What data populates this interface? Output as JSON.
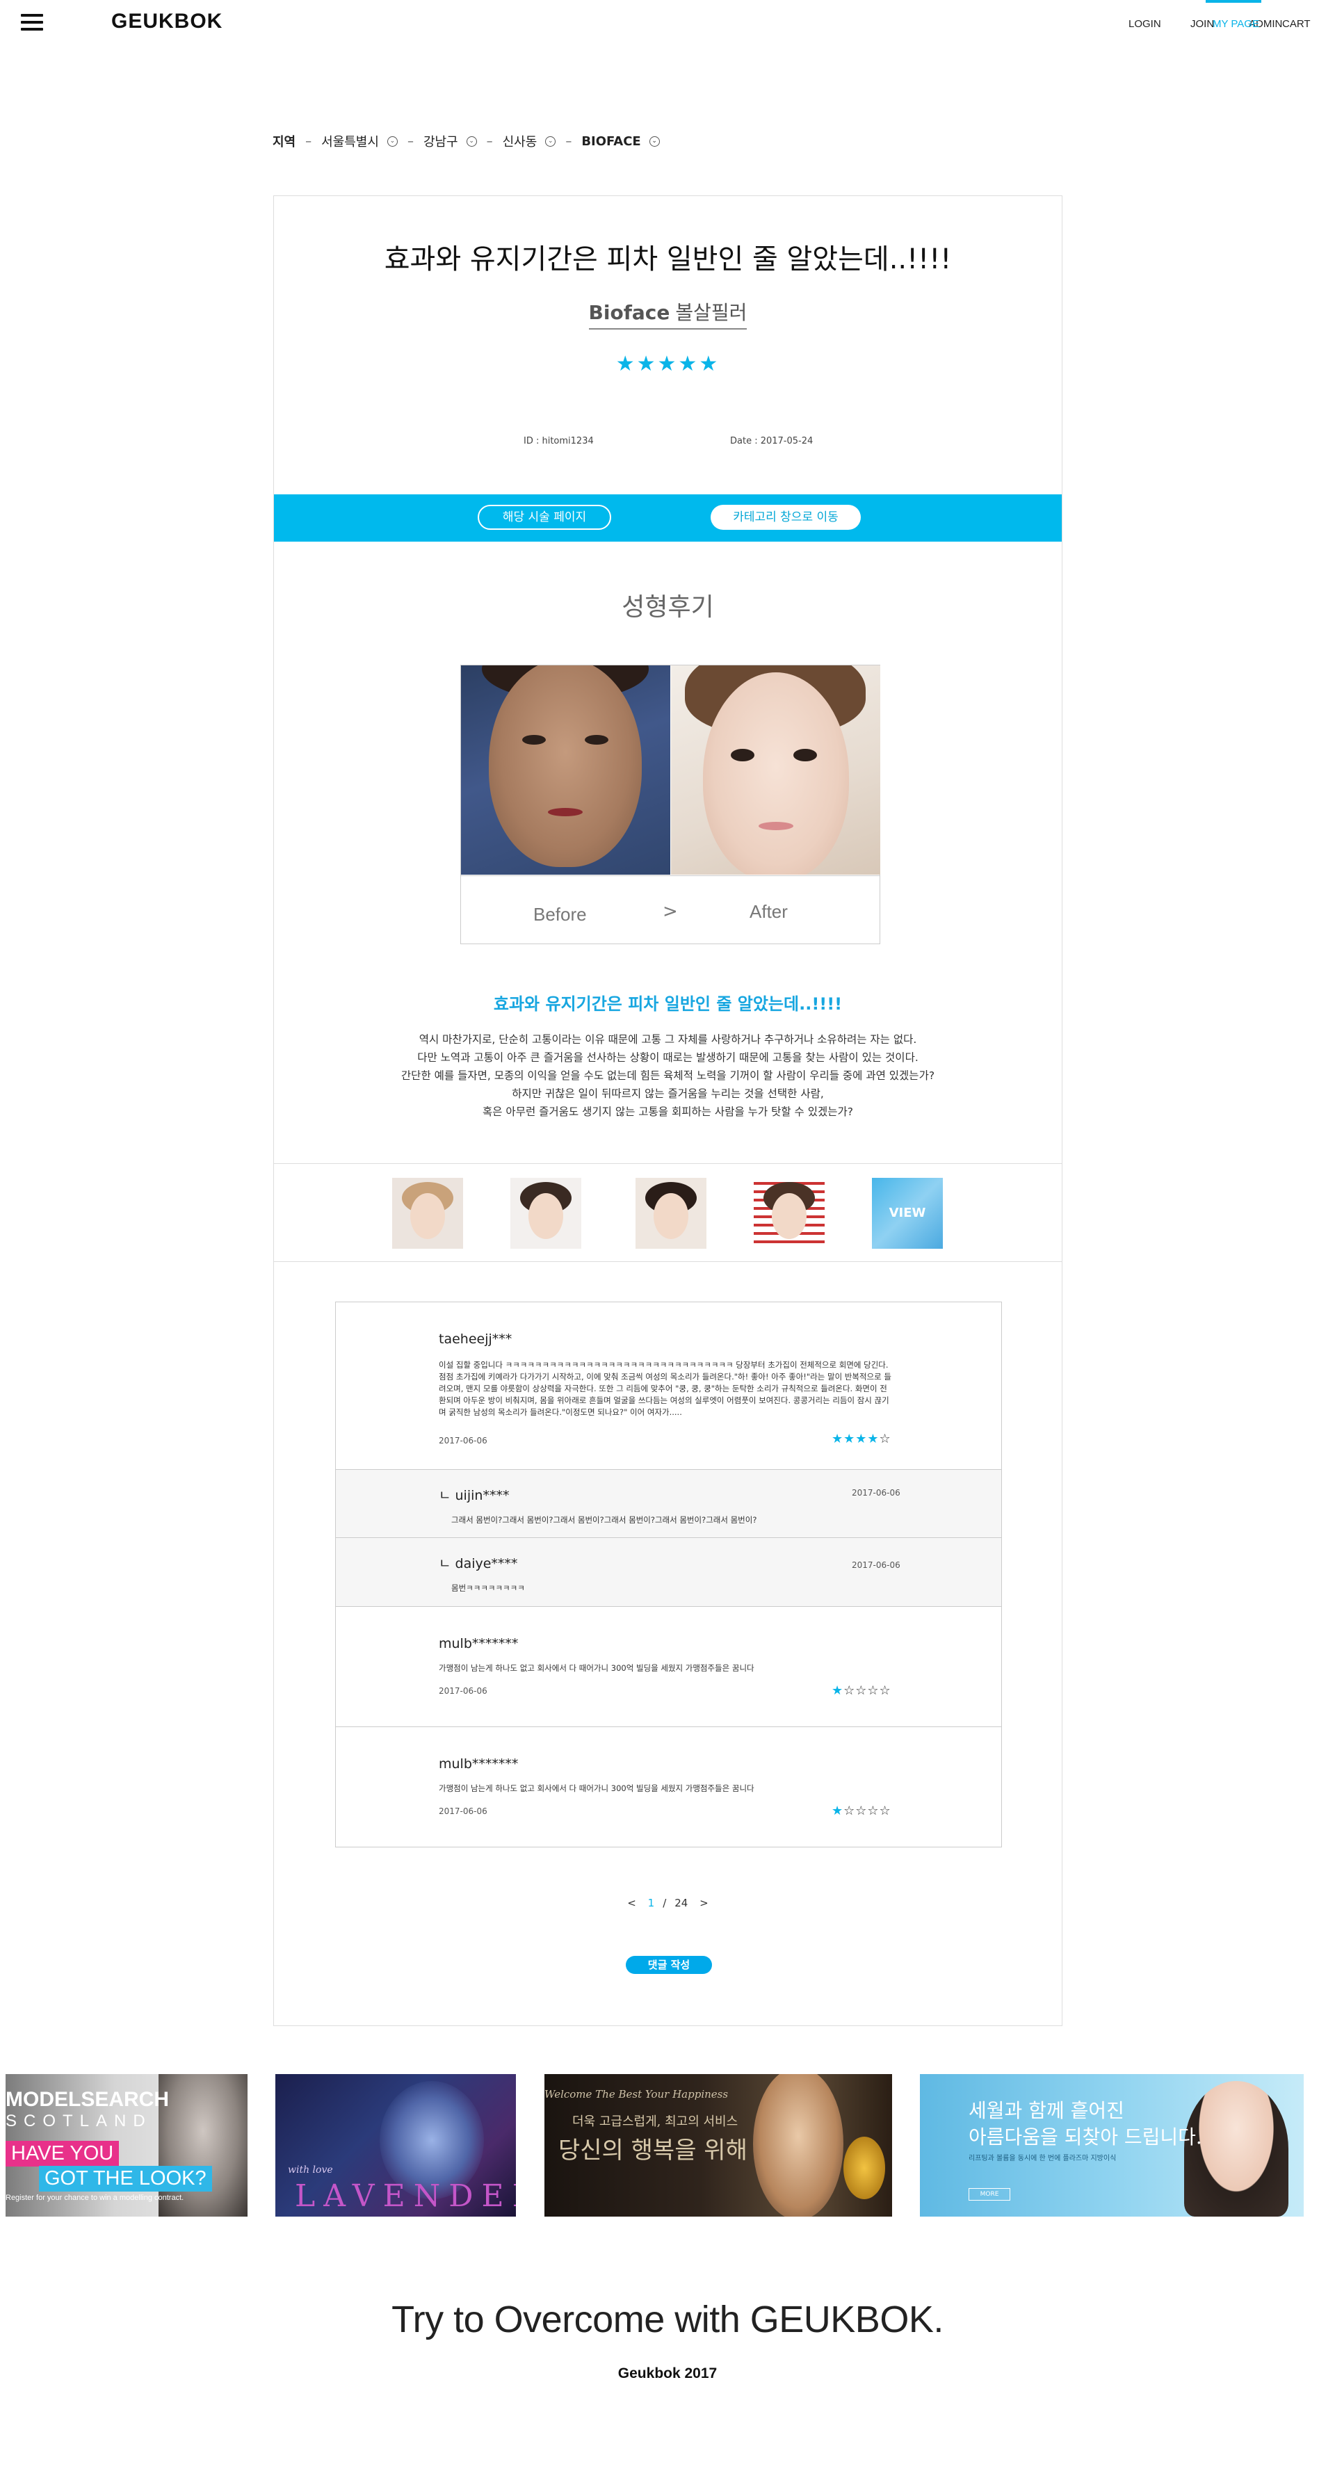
{
  "header": {
    "logo": "GEUKBOK",
    "nav": [
      {
        "label": "LOGIN"
      },
      {
        "label": "JOIN"
      },
      {
        "label": "ADMIN"
      },
      {
        "label": "MY PAGE",
        "active": true
      },
      {
        "label": "CART"
      }
    ]
  },
  "breadcrumb": {
    "root": "지역",
    "items": [
      "서울특별시",
      "강남구",
      "신사동",
      "BIOFACE"
    ],
    "separator": "–"
  },
  "post": {
    "title": "효과와 유지기간은 피차 일반인 줄 알았는데..!!!!",
    "brand": "Bioface",
    "procedure": "볼살필러",
    "rating_stars": "★★★★★",
    "rating": 5,
    "id_text": "ID : hitomi1234",
    "date_text": "Date : 2017-05-24"
  },
  "actions": {
    "procedure_page": "해당 시술 페이지",
    "category_window": "카테고리 창으로 이동"
  },
  "review": {
    "heading": "성형후기",
    "before_label": "Before",
    "arrow": ">",
    "after_label": "After",
    "highlight_title": "효과와 유지기간은 피차 일반인 줄 알았는데..!!!!",
    "body": [
      "역시 마찬가지로, 단순히 고통이라는 이유 때문에 고통 그 자체를 사랑하거나 추구하거나 소유하려는 자는 없다.",
      "다만 노역과 고통이 아주 큰 즐거움을 선사하는 상황이 때로는 발생하기 때문에 고통을 찾는 사람이 있는 것이다.",
      "간단한 예를 들자면, 모종의 이익을 얻을 수도 없는데 힘든 육체적 노력을 기꺼이 할 사람이 우리들 중에 과연 있겠는가?",
      "하지만 귀찮은 일이 뒤따르지 않는 즐거움을 누리는 것을 선택한 사람,",
      "혹은 아무런 즐거움도 생기지 않는 고통을 회피하는 사람을 누가 탓할 수 있겠는가?"
    ],
    "view_label": "VIEW"
  },
  "comments": [
    {
      "author": "taeheejj***",
      "text": "이설 집할 중입니다 ㅋㅋㅋㅋㅋㅋㅋㅋㅋㅋㅋㅋㅋㅋㅋㅋㅋㅋㅋㅋㅋㅋㅋㅋㅋㅋㅋㅋㅋㅋㅋ 당장부터 초가집이 전체적으로 회면에 당긴다. 점점 초가집에 키예라가 다가가기 시작하고, 이에 맞춰 조금씩 여성의 목소리가 들려온다.\"하! 좋아! 아주 좋아!\"라는 말이 반복적으로 들려오며, 맨지 모를 야릇함이 상상력을 자극한다. 또한 그 리듬에 맞추어 \"쿵, 쿵, 쿵\"하는 둔탁한 소리가 규칙적으로 들려온다. 화면이 전환되며 아두운 방이 비춰지며, 몸을 위아래로 흔들며 얼굴을 쓰다듬는 여성의 실루엣이 어렴풋이 보여진다. 콩콩거리는 리듬이 잠시 끊기며 굵직한 남성의 목소리가 들려온다.\"이정도면 되나요?\" 이어 여자가.....",
      "date": "2017-06-06",
      "stars_on": "★★★★",
      "stars_off": "☆",
      "rating": 4
    },
    {
      "author": "ㄴ uijin****",
      "text": "그래서 몸번이?그래서 몸번이?그래서 몸번이?그래서 몸번이?그래서 몸번이?그래서 몸번이?",
      "date": "2017-06-06"
    },
    {
      "author": "ㄴ daiye****",
      "text": "몸번ㅋㅋㅋㅋㅋㅋㅋㅋ",
      "date": "2017-06-06"
    },
    {
      "author": "mulb*******",
      "text": "가맹점이 남는게 하나도 없고 회사에서 다 때어가니 300억 빌딩을 세웠지 가맹점주들은 꿈니다",
      "date": "2017-06-06",
      "stars_on": "★",
      "stars_off": "☆☆☆☆",
      "rating": 1
    },
    {
      "author": "mulb*******",
      "text": "가맹점이 남는게 하나도 없고 회사에서 다 때어가니 300억 빌딩을 세웠지 가맹점주들은 꿈니다",
      "date": "2017-06-06",
      "stars_on": "★",
      "stars_off": "☆☆☆☆",
      "rating": 1
    }
  ],
  "pagination": {
    "prev": "<",
    "current": "1",
    "divider": "/",
    "total": "24",
    "next": ">"
  },
  "write_comment": "댓글 작성",
  "banners": {
    "b1": {
      "line1": "MODELSEARCH",
      "line2": "SCOTLAND",
      "tag1": "HAVE YOU",
      "tag2": "GOT THE LOOK?",
      "small": "Register for your chance to win a modelling contract."
    },
    "b2": {
      "script": "with love",
      "word": "LAVENDER"
    },
    "b3": {
      "script": "Welcome The Best Your Happiness",
      "line1": "더욱 고급스럽게, 최고의 서비스",
      "line2": "당신의 행복을 위해"
    },
    "b4": {
      "line1": "세월과 함께 흩어진",
      "line2": "아름다움을 되찾아 드립니다.",
      "small": "리프팅과 볼륨을 동시에 한 번에 플라즈마 지방이식",
      "btn": "MORE"
    }
  },
  "footer": {
    "tagline": "Try to Overcome with GEUKBOK.",
    "copyright": "Geukbok 2017"
  },
  "colors": {
    "accent": "#00b9ed",
    "star": "#0ab4e8"
  }
}
